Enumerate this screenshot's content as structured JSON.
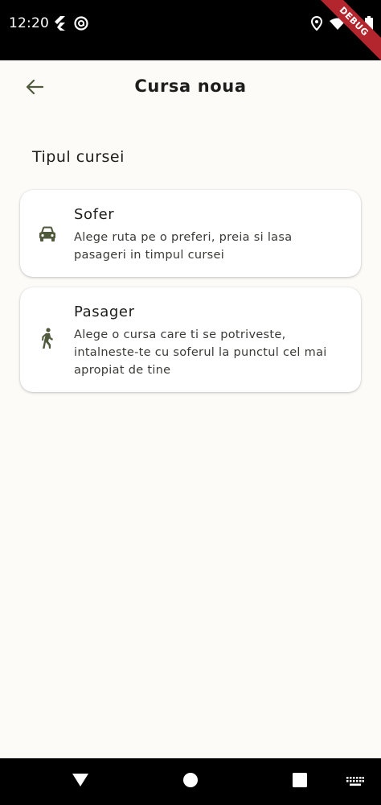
{
  "status_bar": {
    "time": "12:20",
    "left_icons": [
      "flutter-icon",
      "at-sign-icon"
    ],
    "right_icons": [
      "location-icon",
      "wifi-icon",
      "battery-icon"
    ],
    "debug_ribbon": "DEBUG"
  },
  "header": {
    "title": "Cursa noua",
    "back_icon": "arrow-left-icon"
  },
  "section": {
    "title": "Tipul cursei"
  },
  "options": [
    {
      "title": "Sofer",
      "description": "Alege ruta pe o preferi, preia si lasa pasageri in timpul cursei",
      "icon": "car-icon"
    },
    {
      "title": "Pasager",
      "description": "Alege o cursa care ti se potriveste, intalneste-te cu soferul la punctul cel mai apropiat de tine",
      "icon": "walking-person-icon"
    }
  ],
  "nav_bar": {
    "icons": [
      "back-triangle-icon",
      "home-circle-icon",
      "recents-square-icon",
      "keyboard-icon"
    ]
  },
  "colors": {
    "background": "#fcfbf8",
    "card": "#ffffff",
    "accent": "#4f5a3c",
    "text": "#1d1d1b",
    "system_bar": "#000000",
    "debug_ribbon": "#b3262e"
  }
}
